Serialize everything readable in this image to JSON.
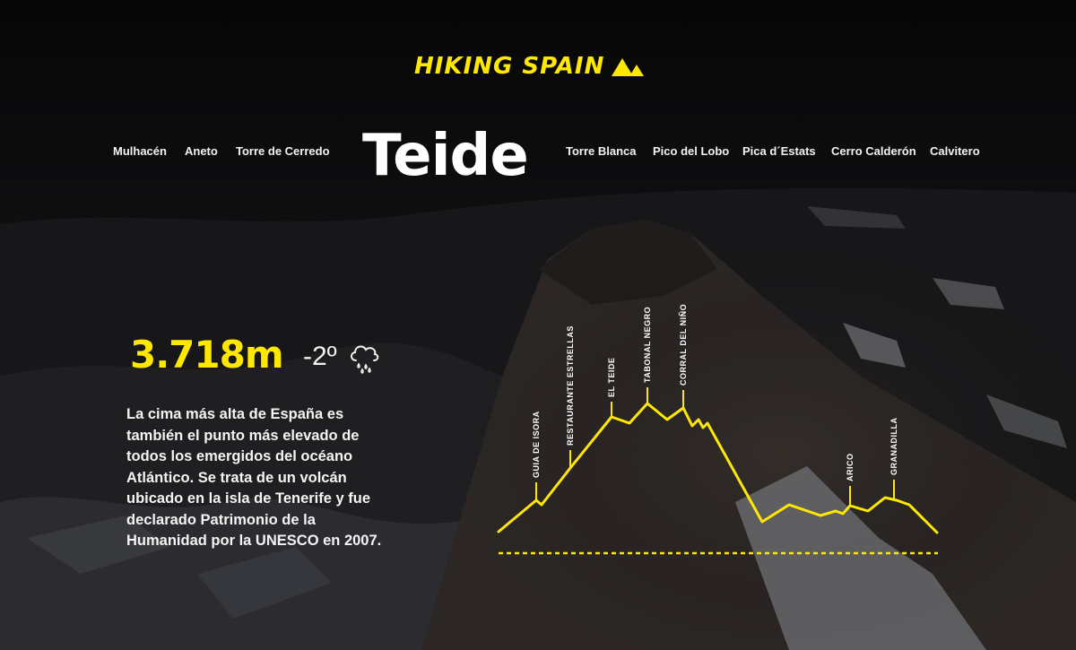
{
  "brand": {
    "logo_text": "HIKING SPAIN",
    "accent_color": "#ffe800",
    "logo_icon": "mountain-peaks-icon"
  },
  "nav": {
    "left": [
      "Mulhacén",
      "Aneto",
      "Torre de Cerredo"
    ],
    "right": [
      "Torre Blanca",
      "Pico del Lobo",
      "Pica d´Estats",
      "Cerro Calderón",
      "Calvitero"
    ]
  },
  "page_title": "Teide",
  "stats": {
    "elevation": "3.718m",
    "temperature": "-2º",
    "weather_icon": "cloud-rain-icon"
  },
  "description": "La cima más alta de España es también el punto más elevado de todos los emergidos del océano Atlántico. Se trata de un volcán ubicado en la isla de Tenerife y fue declarado Patrimonio de la Humanidad por la UNESCO en 2007.",
  "route_profile": {
    "waypoints": [
      "GUIA DE ISORA",
      "RESTAURANTE ESTRELLAS",
      "EL TEIDE",
      "TABONAL NEGRO",
      "CORRAL DEL NIÑO",
      "ARICO",
      "GRANADILLA"
    ]
  }
}
